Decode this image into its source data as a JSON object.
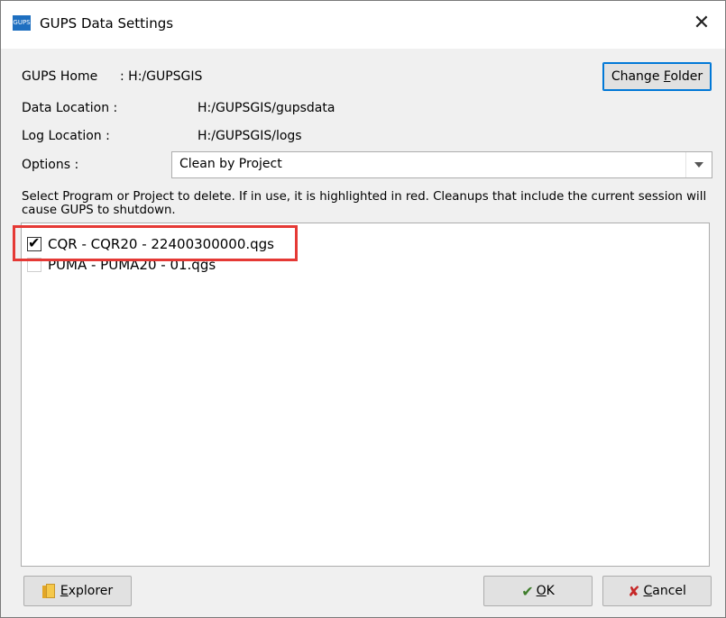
{
  "window": {
    "title": "GUPS Data Settings",
    "app_icon_text": "GUPS",
    "close_glyph": "✕"
  },
  "home": {
    "label": "GUPS Home",
    "sep": ": H:/GUPSGIS"
  },
  "change_folder": {
    "pre": "Change ",
    "mnemonic": "F",
    "post": "older"
  },
  "data_location": {
    "label": "Data Location :",
    "value": "H:/GUPSGIS/gupsdata"
  },
  "log_location": {
    "label": "Log Location :",
    "value": "H:/GUPSGIS/logs"
  },
  "options": {
    "label": "Options :",
    "selected": "Clean by Project"
  },
  "description": "Select Program or Project to delete. If in use, it is highlighted in red. Cleanups that include the current session will cause GUPS to shutdown.",
  "items": [
    {
      "label": "CQR - CQR20 - 22400300000.qgs",
      "checked": true
    },
    {
      "label": "PUMA - PUMA20 - 01.qgs",
      "checked": false
    }
  ],
  "buttons": {
    "explorer": {
      "mnemonic": "E",
      "rest": "xplorer",
      "icon": "folder-icon"
    },
    "ok": {
      "mnemonic": "O",
      "rest": "K",
      "icon": "ok-check-icon"
    },
    "cancel": {
      "mnemonic": "C",
      "rest": "ancel",
      "icon": "cancel-x-icon"
    }
  },
  "colors": {
    "highlight": "#e53935",
    "focus": "#0078d7",
    "app_icon": "#1e6fc0"
  }
}
